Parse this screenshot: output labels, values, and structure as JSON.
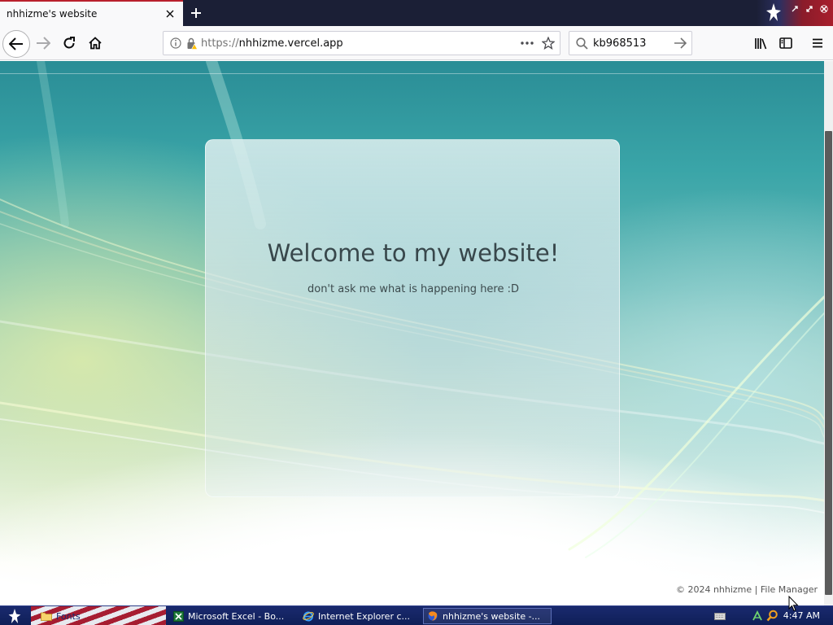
{
  "browser": {
    "tab": {
      "title": "nhhizme's website"
    },
    "url": {
      "scheme": "https://",
      "host": "nhhizme.vercel.app"
    },
    "search": {
      "value": "kb968513"
    }
  },
  "page": {
    "title": "Welcome to my website!",
    "subtitle": "don't ask me what is happening here :D",
    "footer": {
      "copyright": "© 2024 nhhizme | ",
      "link": "File Manager"
    }
  },
  "taskbar": {
    "items": [
      {
        "label": "Fonts",
        "icon": "folder-icon"
      },
      {
        "label": "Microsoft Excel - Bo...",
        "icon": "excel-icon"
      },
      {
        "label": "Internet Explorer c...",
        "icon": "ie-icon"
      },
      {
        "label": "nhhizme's website -...",
        "icon": "firefox-icon"
      }
    ],
    "clock": "4:47 AM"
  },
  "colors": {
    "tab_accent": "#b9202c",
    "taskbar": "#1a2a6e",
    "title_text": "#38474b"
  }
}
